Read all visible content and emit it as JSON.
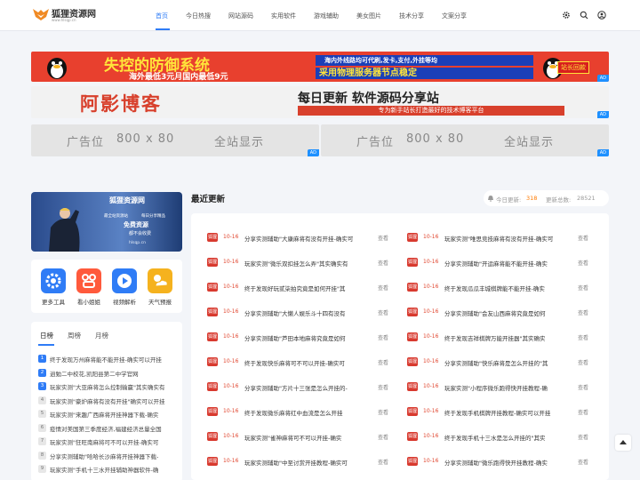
{
  "brand": {
    "name": "狐狸资源网",
    "url": "www.hlsqp.cn"
  },
  "nav": [
    {
      "label": "首页",
      "active": true
    },
    {
      "label": "今日热搜"
    },
    {
      "label": "网站源码"
    },
    {
      "label": "实用软件"
    },
    {
      "label": "游戏辅助"
    },
    {
      "label": "美女图片"
    },
    {
      "label": "技术分享"
    },
    {
      "label": "文案分享"
    }
  ],
  "header_icons": [
    "gear-icon",
    "search-icon",
    "user-icon"
  ],
  "banners": {
    "b1": {
      "title": "失控的防御系统",
      "sub": "海外最低3元月国内最低9元",
      "right1": "海内外线路均可代刷,发卡,支付,外挂等均",
      "right2": "采用物理服务器节点稳定",
      "badge": "站长回款",
      "ad": "AD"
    },
    "b2": {
      "title": "阿影博客",
      "right1": "每日更新 软件源码分享站",
      "right2": "专为新手站长打造最好的技术博客平台",
      "ad": "AD"
    },
    "ad_left": {
      "a": "广告位",
      "b": "800 x 80",
      "c": "全站显示",
      "ad": "AD"
    },
    "ad_right": {
      "a": "广告位",
      "b": "800 x 80",
      "c": "全站显示",
      "ad": "AD"
    }
  },
  "hero": {
    "brand": "狐狸资源网",
    "l1": "最全站资源站",
    "l2": "每日分享精品",
    "l3": "免费资源",
    "l4": "都不会收费",
    "url": "hlsqp.cn"
  },
  "tools": [
    {
      "label": "更多工具",
      "icon": "gear-icon",
      "color": "#2f7cf6"
    },
    {
      "label": "看小姐姐",
      "icon": "link-icon",
      "color": "#ff5a3c"
    },
    {
      "label": "视频解析",
      "icon": "play-icon",
      "color": "#2f7cf6"
    },
    {
      "label": "天气预报",
      "icon": "weather-icon",
      "color": "#f5b21e"
    }
  ],
  "rank": {
    "tabs": [
      "日榜",
      "周榜",
      "月榜"
    ],
    "items": [
      "终于发现万州麻将能不能开挂-确实可以开挂",
      "逍勉二中校花,凯阳县第二中学官网",
      "玩家实测\"大亚麻将怎么控制输赢\"其实确实有",
      "玩家实测\"豪炉麻将有没有开挂\"确实可以开挂",
      "玩家实测\"来趣广西麻将开挂神器下载-确实",
      "疫情对美国第三季度经济,福建经济总量全国",
      "玩家实测\"狂旺南麻将可不可以开挂-确实可",
      "分享实测辅助\"哈哈长沙麻将开挂神器下载-",
      "玩家实测\"手机十三水开挂辅助神器软件-确"
    ]
  },
  "recent": {
    "title": "最近更新",
    "today_label": "今日更新:",
    "today_value": "318",
    "total_label": "更新总数:",
    "total_value": "28521",
    "view_label": "查看",
    "badge_label": "狐狸",
    "date": "10-16",
    "left": [
      "分享实测辅助\"大康麻将有没有开挂-确实可",
      "玩家实测\"微乐双扣挂怎么弄\"其实确实有",
      "终于发现好玩贰柒拍究竟是如何开挂\"其",
      "分享实测辅助\"大懒人娱乐斗十四有没有",
      "分享实测辅助\"芦田本地麻将究竟是如何",
      "终于发现快乐麻将可不可以开挂-确实可",
      "分享实测辅助\"方片十三张是怎么开挂的-",
      "终于发现微乐麻将红中血流是怎么开挂",
      "玩家实测\"雀神麻将可不可以开挂-确实",
      "玩家实测辅助\"中至讨赏开挂教程-确实可"
    ],
    "right": [
      "玩家实测\"唯思竞技麻将有没有开挂-确实可",
      "分享实测辅助\"开运麻将能不能开挂-确实",
      "终于发现瓜瓜丰城棋牌能不能开挂-确实",
      "分享实测辅助\"会友山西麻将究竟是如何",
      "终于发现吉祥棋牌万能开挂器\"其实确实",
      "分享实测辅助\"快乐麻将是怎么开挂的\"其",
      "玩家实测\"小程序微乐跑得快开挂教程-确",
      "终于发现手机棋牌开挂教程-确实可以开挂",
      "终于发现手机十三水是怎么开挂的\"其实",
      "分享实测辅助\"微乐跑得快开挂教程-确实"
    ]
  }
}
